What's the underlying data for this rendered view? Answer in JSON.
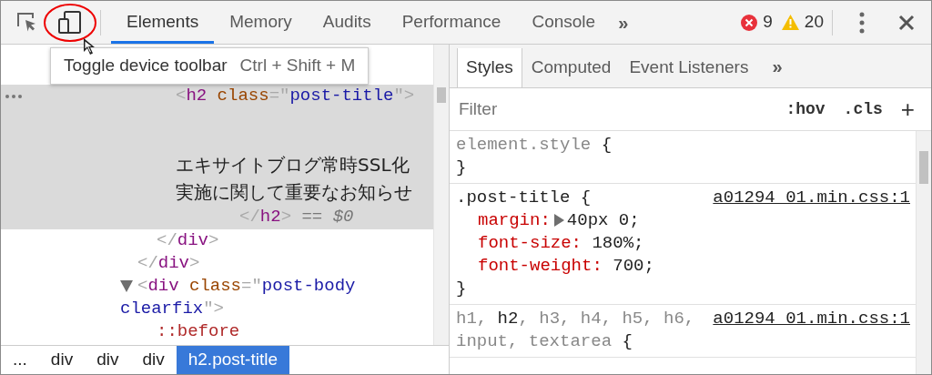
{
  "toolbar": {
    "tabs": [
      {
        "label": "Elements",
        "selected": true
      },
      {
        "label": "Memory",
        "selected": false
      },
      {
        "label": "Audits",
        "selected": false
      },
      {
        "label": "Performance",
        "selected": false
      },
      {
        "label": "Console",
        "selected": false
      }
    ],
    "overflow": "»",
    "errors": "9",
    "warnings": "20"
  },
  "tooltip": {
    "label": "Toggle device toolbar",
    "shortcut": "Ctrl + Shift + M"
  },
  "dom_tree": [
    {
      "kind": "element",
      "selected": false,
      "children": [
        {
          "kind": "element",
          "selected": false,
          "children": [
            {
              "kind": "element",
              "selected": true,
              "open": [
                {
                  "kind": "punct",
                  "text": "<"
                },
                {
                  "kind": "tag",
                  "text": "h2"
                },
                {
                  "kind": "attr",
                  "text": "class"
                },
                {
                  "kind": "punct",
                  "text": "=\""
                },
                {
                  "kind": "value",
                  "text": "post-title"
                },
                {
                  "kind": "punct",
                  "text": "\">"
                }
              ],
              "text": "エキサイトブログ常時SSL化実施に関して重要なお知らせ",
              "close": [
                {
                  "kind": "punct",
                  "text": "</"
                },
                {
                  "kind": "tag",
                  "text": "h2"
                },
                {
                  "kind": "punct",
                  "text": ">"
                }
              ],
              "marker": "== $0"
            }
          ],
          "close": [
            {
              "kind": "punct",
              "text": "</"
            },
            {
              "kind": "tag",
              "text": "div"
            },
            {
              "kind": "punct",
              "text": ">"
            }
          ]
        }
      ],
      "close": [
        {
          "kind": "punct",
          "text": "</"
        },
        {
          "kind": "tag",
          "text": "div"
        },
        {
          "kind": "punct",
          "text": ">"
        }
      ]
    },
    {
      "kind": "element",
      "selected": false,
      "expanded": true,
      "open": [
        {
          "kind": "punct",
          "text": "<"
        },
        {
          "kind": "tag",
          "text": "div"
        },
        {
          "kind": "attr",
          "text": "class"
        },
        {
          "kind": "punct",
          "text": "=\""
        },
        {
          "kind": "value",
          "text": "post-body clearfix"
        },
        {
          "kind": "punct",
          "text": "\">"
        }
      ],
      "children": [
        {
          "kind": "pseudo",
          "selected": false,
          "text": "::before"
        }
      ]
    }
  ],
  "breadcrumbs": [
    {
      "label": "...",
      "selected": false
    },
    {
      "label": "div",
      "selected": false
    },
    {
      "label": "div",
      "selected": false
    },
    {
      "label": "div",
      "selected": false
    },
    {
      "label": "h2.post-title",
      "selected": true
    }
  ],
  "sidebar_tabs": [
    {
      "label": "Styles",
      "selected": true
    },
    {
      "label": "Computed",
      "selected": false
    },
    {
      "label": "Event Listeners",
      "selected": false
    }
  ],
  "sidebar_overflow": "»",
  "filter": {
    "placeholder": "Filter",
    "hov": ":hov",
    "cls": ".cls",
    "add": "+"
  },
  "style_rules": [
    {
      "selector": [
        {
          "text": "element.style",
          "matched": false
        }
      ],
      "open": "{",
      "close": "}"
    },
    {
      "selector": [
        {
          "text": ".post-title",
          "matched": true
        }
      ],
      "open": "{",
      "source": "a01294_01.min.css:1",
      "declarations": [
        {
          "property": "margin:",
          "value": "40px 0;",
          "expandable": true
        },
        {
          "property": "font-size:",
          "value": "180%;",
          "expandable": false
        },
        {
          "property": "font-weight:",
          "value": "700;",
          "expandable": false
        }
      ],
      "close": "}"
    },
    {
      "selector": [
        {
          "text": "h1, ",
          "matched": false
        },
        {
          "text": "h2",
          "matched": true
        },
        {
          "text": ", h3, h4, h5, h6, input, textarea",
          "matched": false
        }
      ],
      "open": "{",
      "source": "a01294_01.min.css:1"
    }
  ]
}
